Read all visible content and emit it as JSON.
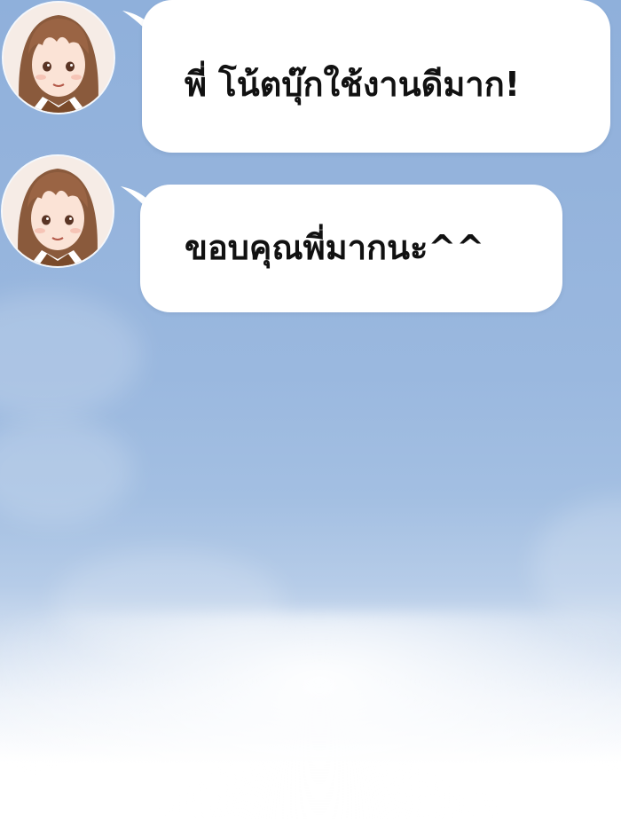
{
  "messages": [
    {
      "text": "พี่ โน้ตบุ๊กใช้งานดีมาก!"
    },
    {
      "text": "ขอบคุณพี่มากนะ^^"
    }
  ]
}
